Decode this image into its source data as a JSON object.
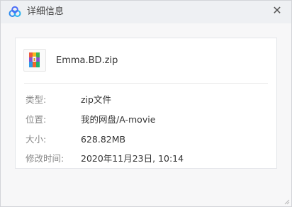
{
  "window": {
    "title": "详细信息",
    "icons": {
      "app": "baidu-netdisk-cloud-icon",
      "close": "close-icon"
    },
    "colors": {
      "title_bg": "#eef0f3",
      "card_bg": "#ffffff",
      "label": "#888888"
    }
  },
  "file": {
    "name": "Emma.BD.zip",
    "icon": "zip-archive-icon"
  },
  "details": [
    {
      "label": "类型:",
      "value": "zip文件"
    },
    {
      "label": "位置:",
      "value": "我的网盘/A-movie"
    },
    {
      "label": "大小:",
      "value": "628.82MB"
    },
    {
      "label": "修改时间:",
      "value": "2020年11月23日, 10:14"
    }
  ]
}
